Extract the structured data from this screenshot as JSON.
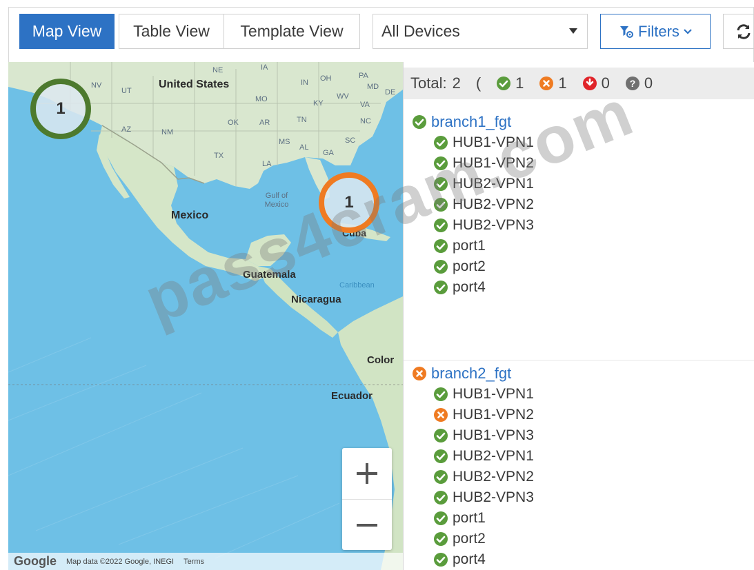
{
  "toolbar": {
    "tabs": [
      {
        "label": "Map View",
        "active": true
      },
      {
        "label": "Table View",
        "active": false
      },
      {
        "label": "Template View",
        "active": false
      }
    ],
    "device_select": {
      "value": "All Devices"
    },
    "filters_label": "Filters",
    "accent_color": "#2d72c4"
  },
  "map": {
    "clusters": [
      {
        "count": "1",
        "status_color": "#4d7a2e"
      },
      {
        "count": "1",
        "status_color": "#ef7b22"
      }
    ],
    "labels": {
      "united_states": "United States",
      "mexico": "Mexico",
      "gulf": "Gulf of Mexico",
      "cuba": "Cuba",
      "guatemala": "Guatemala",
      "nicaragua": "Nicaragua",
      "colombia": "Color",
      "ecuador": "Ecuador",
      "caribbean": "Caribbean",
      "states": [
        "NV",
        "UT",
        "NE",
        "IA",
        "IN",
        "OH",
        "PA",
        "MO",
        "KY",
        "WV",
        "VA",
        "NC",
        "SC",
        "GA",
        "AL",
        "MS",
        "LA",
        "TX",
        "OK",
        "AR",
        "TN",
        "AZ",
        "NM",
        "MD",
        "DE"
      ]
    },
    "zoom_in": "+",
    "zoom_out": "−",
    "attribution": {
      "logo": "Google",
      "data": "Map data ©2022 Google, INEGI",
      "terms": "Terms"
    }
  },
  "summary": {
    "total_label": "Total:",
    "total": "2",
    "open_paren": "(",
    "up": "1",
    "warning": "1",
    "down": "0",
    "unknown": "0"
  },
  "devices": [
    {
      "name": "branch1_fgt",
      "status": "up",
      "interfaces": [
        {
          "name": "HUB1-VPN1",
          "status": "up"
        },
        {
          "name": "HUB1-VPN2",
          "status": "up"
        },
        {
          "name": "HUB2-VPN1",
          "status": "up"
        },
        {
          "name": "HUB2-VPN2",
          "status": "up"
        },
        {
          "name": "HUB2-VPN3",
          "status": "up"
        },
        {
          "name": "port1",
          "status": "up"
        },
        {
          "name": "port2",
          "status": "up"
        },
        {
          "name": "port4",
          "status": "up"
        }
      ]
    },
    {
      "name": "branch2_fgt",
      "status": "warning",
      "interfaces": [
        {
          "name": "HUB1-VPN1",
          "status": "up"
        },
        {
          "name": "HUB1-VPN2",
          "status": "warning"
        },
        {
          "name": "HUB1-VPN3",
          "status": "up"
        },
        {
          "name": "HUB2-VPN1",
          "status": "up"
        },
        {
          "name": "HUB2-VPN2",
          "status": "up"
        },
        {
          "name": "HUB2-VPN3",
          "status": "up"
        },
        {
          "name": "port1",
          "status": "up"
        },
        {
          "name": "port2",
          "status": "up"
        },
        {
          "name": "port4",
          "status": "up"
        }
      ]
    }
  ],
  "status_colors": {
    "up": "#5a9c3c",
    "warning": "#ef7b22",
    "down": "#e0242a",
    "unknown": "#707070"
  },
  "watermark": "pass4cram.com"
}
